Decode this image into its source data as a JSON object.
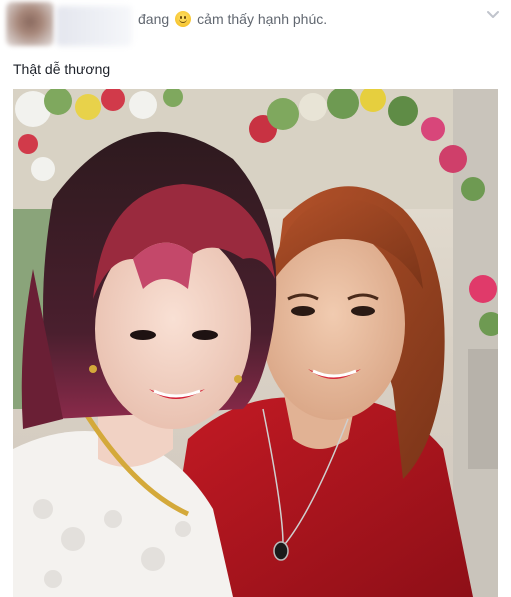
{
  "post": {
    "status_verb": "đang",
    "feeling_icon": "smiling-face-icon",
    "feeling_text": "cảm thấy hạnh phúc.",
    "options_icon": "chevron-down-icon",
    "caption": "Thật dễ thương",
    "photo_alt": "Selfie of two women smiling",
    "colors": {
      "meta_text": "#616770",
      "body_text": "#1d2129",
      "feeling_yellow": "#f7c531",
      "red_dress": "#b3121c"
    }
  }
}
